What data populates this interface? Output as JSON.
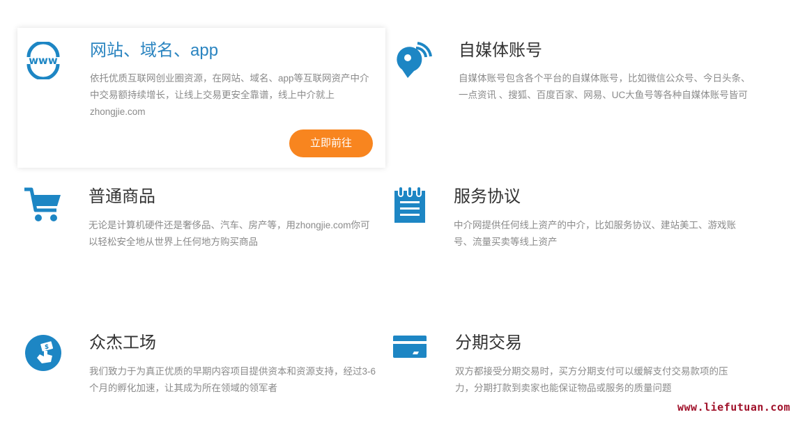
{
  "features": [
    {
      "title": "网站、域名、app",
      "description": "依托优质互联网创业圈资源，在网站、域名、app等互联网资产中介中交易额持续增长，让线上交易更安全靠谱，线上中介就上zhongjie.com",
      "button_label": "立即前往",
      "icon": "www-globe-icon"
    },
    {
      "title": "自媒体账号",
      "description": "自媒体账号包含各个平台的自媒体账号，比如微信公众号、今日头条、一点资讯 、搜狐、百度百家、网易、UC大鱼号等各种自媒体账号皆可",
      "icon": "broadcast-pin-icon"
    },
    {
      "title": "普通商品",
      "description": "无论是计算机硬件还是奢侈品、汽车、房产等，用zhongjie.com你可以轻松安全地从世界上任何地方购买商品",
      "icon": "shopping-cart-icon"
    },
    {
      "title": "服务协议",
      "description": "中介网提供任何线上资产的中介，比如服务协议、建站美工、游戏账号、流量买卖等线上资产",
      "icon": "notepad-icon"
    },
    {
      "title": "众杰工场",
      "description": "我们致力于为真正优质的早期内容项目提供资本和资源支持，经过3-6 个月的孵化加速，让其成为所在领域的领军者",
      "icon": "hand-money-icon"
    },
    {
      "title": "分期交易",
      "description": "双方都接受分期交易时，买方分期支付可以缓解支付交易款项的压力，分期打款到卖家也能保证物品或服务的质量问题",
      "icon": "credit-card-icon"
    }
  ],
  "watermark": "www.liefutuan.com",
  "colors": {
    "icon_blue": "#1d86c4",
    "title_accent": "#2a84c0",
    "button_orange": "#f8851f",
    "watermark": "#a0112a"
  }
}
